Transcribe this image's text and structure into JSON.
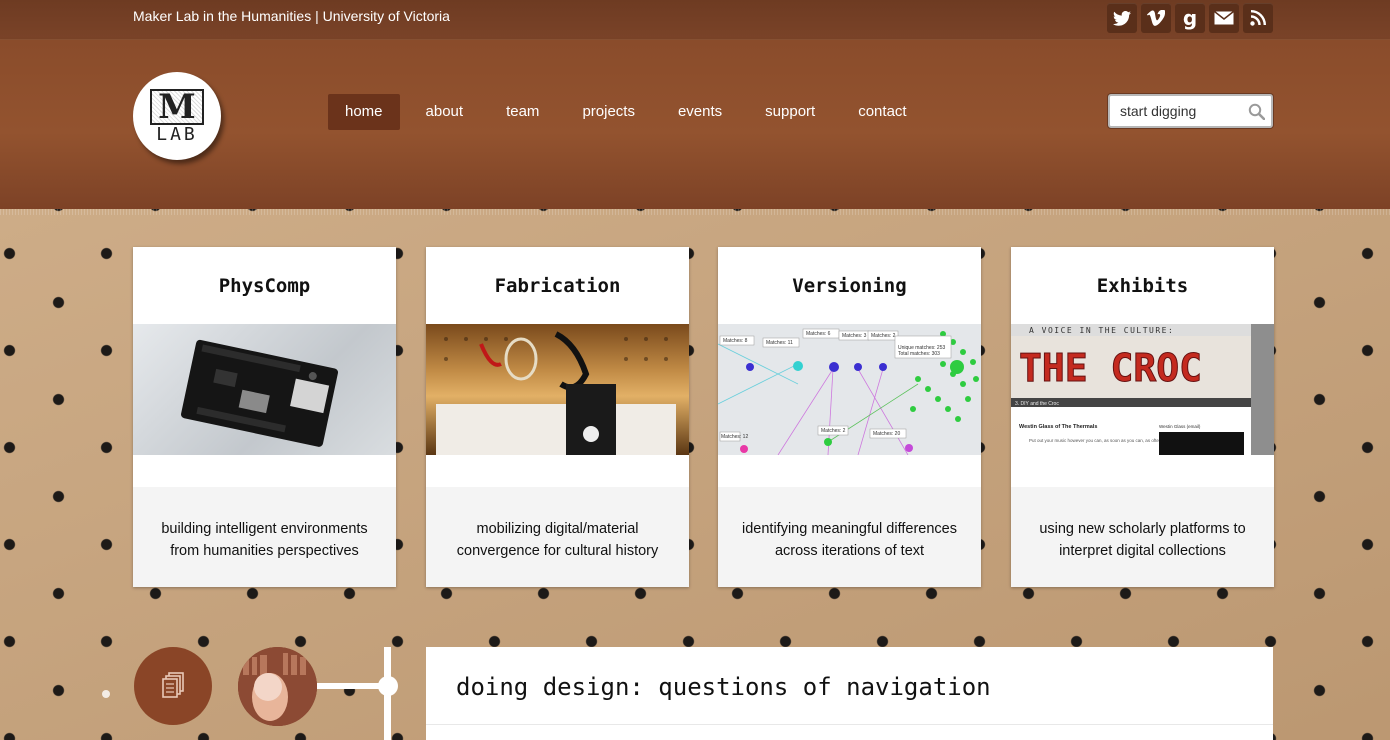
{
  "site": {
    "title": "Maker Lab in the Humanities | University of Victoria"
  },
  "social": [
    {
      "icon": "twitter-icon",
      "glyph": "t"
    },
    {
      "icon": "vimeo-icon",
      "glyph": "v"
    },
    {
      "icon": "goodreads-icon",
      "glyph": "g"
    },
    {
      "icon": "email-icon",
      "glyph": "✉"
    },
    {
      "icon": "rss-icon",
      "glyph": "◉"
    }
  ],
  "logo": {
    "letter": "M",
    "word": "LAB"
  },
  "nav": {
    "items": [
      {
        "label": "home",
        "active": true
      },
      {
        "label": "about"
      },
      {
        "label": "team"
      },
      {
        "label": "projects"
      },
      {
        "label": "events"
      },
      {
        "label": "support"
      },
      {
        "label": "contact"
      }
    ]
  },
  "search": {
    "placeholder": "start digging"
  },
  "cards": [
    {
      "title": "PhysComp",
      "desc_line1": "building intelligent environments",
      "desc_line2": "from humanities perspectives"
    },
    {
      "title": "Fabrication",
      "desc_line1": "mobilizing digital/material",
      "desc_line2": "convergence for cultural history"
    },
    {
      "title": "Versioning",
      "desc_line1": "identifying meaningful differences",
      "desc_line2": "across iterations of text"
    },
    {
      "title": "Exhibits",
      "desc_line1": "using new scholarly platforms to",
      "desc_line2": "interpret digital collections"
    }
  ],
  "versioning_img": {
    "labels": [
      "Matches: 8",
      "Matches: 11",
      "Matches: 6",
      "Matches: 3",
      "Matches: 2",
      "Unique matches: 253",
      "Total matches: 303",
      "Matches: 2",
      "Matches: 20",
      "Matches: 12"
    ]
  },
  "exhibits_img": {
    "banner": "A VOICE IN THE CULTURE:",
    "headline": "THE CROC",
    "caption": "3. DIY and the Croc",
    "article_title": "Westin Glass of The Thermals",
    "article_text": "Put out your music however you can, as soon as you can, as often as you can! Don't wait for someone to",
    "sidebar_title": "Westin Glass (email)"
  },
  "post": {
    "title": "doing design: questions of navigation"
  },
  "colors": {
    "header": "#93532f",
    "topbar": "#6e3b22",
    "active_nav": "#6b331b",
    "accent_circle": "#8a4527"
  }
}
